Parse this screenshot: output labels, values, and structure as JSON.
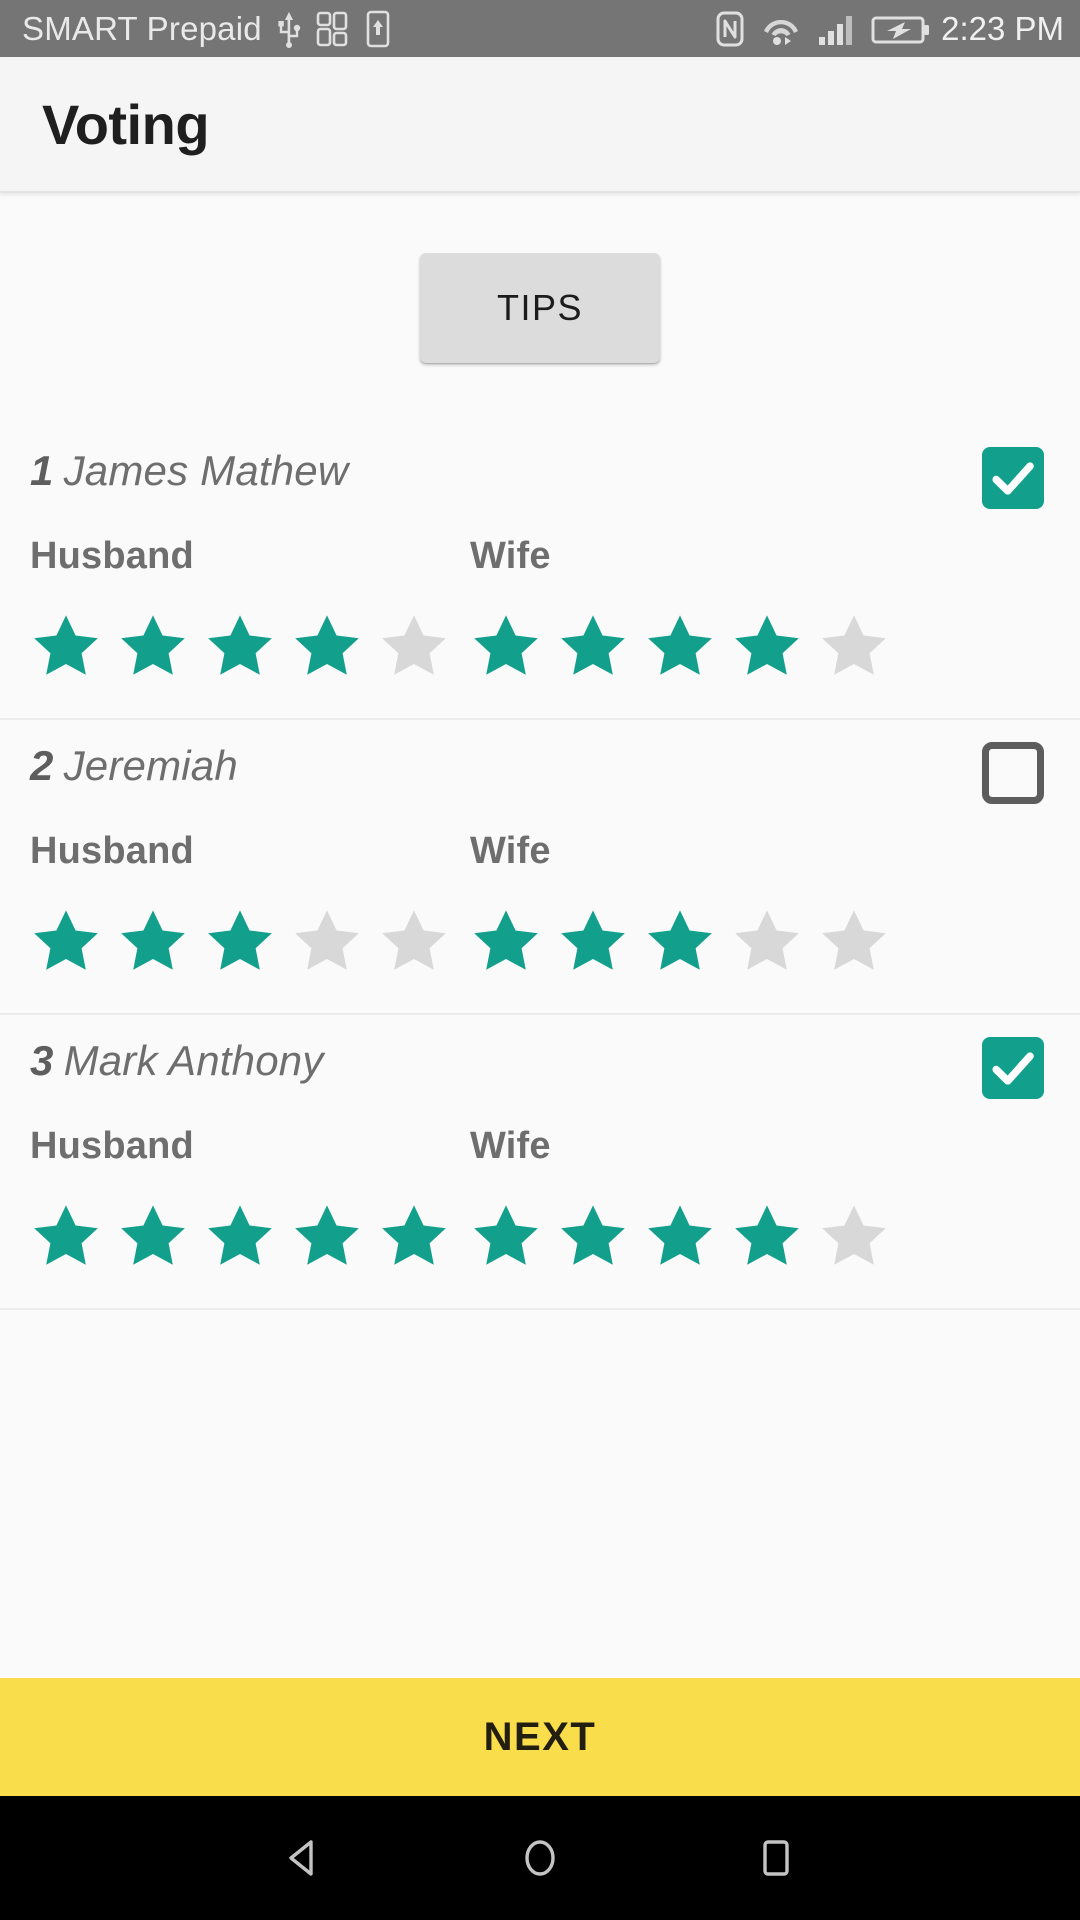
{
  "status_bar": {
    "carrier": "SMART Prepaid",
    "time": "2:23 PM",
    "left_icons": [
      "usb-icon",
      "apps-grid-icon",
      "cast-screen-icon"
    ],
    "right_icons": [
      "nfc-icon",
      "wifi-icon",
      "cellular-signal-icon",
      "battery-charging-icon"
    ]
  },
  "header": {
    "title": "Voting"
  },
  "toolbar": {
    "tips_label": "TIPS"
  },
  "candidates": [
    {
      "number": "1",
      "name": "James Mathew",
      "selected": true,
      "roles": [
        {
          "label": "Husband",
          "rating": 4,
          "max": 5
        },
        {
          "label": "Wife",
          "rating": 4,
          "max": 5
        }
      ]
    },
    {
      "number": "2",
      "name": "Jeremiah",
      "selected": false,
      "roles": [
        {
          "label": "Husband",
          "rating": 3,
          "max": 5
        },
        {
          "label": "Wife",
          "rating": 3,
          "max": 5
        }
      ]
    },
    {
      "number": "3",
      "name": "Mark Anthony",
      "selected": true,
      "roles": [
        {
          "label": "Husband",
          "rating": 5,
          "max": 5
        },
        {
          "label": "Wife",
          "rating": 4,
          "max": 5
        }
      ]
    }
  ],
  "footer": {
    "next_label": "NEXT"
  },
  "nav_bar": {
    "items": [
      "back-icon",
      "home-icon",
      "recents-icon"
    ]
  },
  "colors": {
    "accent_teal": "#12a08c",
    "star_empty": "#d8d8d8",
    "next_yellow": "#f9dd4a",
    "status_bar": "#757575",
    "title_text": "#1f1f1f",
    "label_gray": "#6e6e6e"
  }
}
